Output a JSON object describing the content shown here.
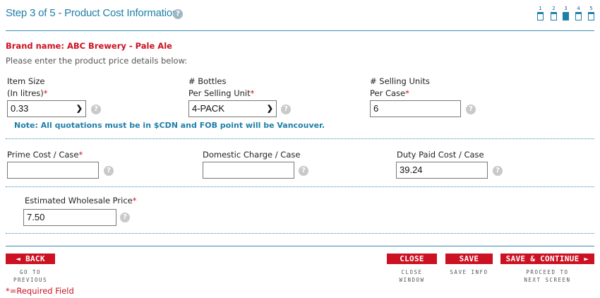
{
  "header": {
    "title": "Step 3 of 5 - Product Cost Information",
    "help_icon": "?",
    "steps": [
      "1",
      "2",
      "3",
      "4",
      "5"
    ]
  },
  "brand": "Brand name: ABC Brewery - Pale Ale",
  "intro": "Please enter the product price details below:",
  "item_size": {
    "label_line1": "Item Size",
    "label_line2": "(In litres)",
    "required": "*",
    "value": "0.33"
  },
  "bottles": {
    "label_line1": "# Bottles",
    "label_line2": "Per Selling Unit",
    "required": "*",
    "value": "4-PACK"
  },
  "selling_units": {
    "label_line1": "# Selling Units",
    "label_line2": "Per Case",
    "required": "*",
    "value": "6"
  },
  "note": "Note: All quotations must be in $CDN and FOB point will be Vancouver.",
  "prime_cost": {
    "label": "Prime Cost / Case",
    "required": "*",
    "value": ""
  },
  "domestic_charge": {
    "label": "Domestic Charge / Case",
    "value": ""
  },
  "duty_paid": {
    "label": "Duty Paid Cost / Case",
    "value": "39.24"
  },
  "wholesale": {
    "label": "Estimated Wholesale Price",
    "required": "*",
    "value": "7.50"
  },
  "buttons": {
    "back": {
      "label": "◄ BACK",
      "sub1": "GO TO",
      "sub2": "PREVIOUS"
    },
    "close": {
      "label": "CLOSE",
      "sub1": "CLOSE",
      "sub2": "WINDOW"
    },
    "save": {
      "label": "SAVE",
      "sub1": "SAVE INFO"
    },
    "save_continue": {
      "label": "SAVE & CONTINUE ►",
      "sub1": "PROCEED TO",
      "sub2": "NEXT SCREEN"
    }
  },
  "required_note": "*=Required Field",
  "colors": {
    "accent": "#1f7fa8",
    "required": "#cc1122",
    "button": "#cc1122"
  }
}
